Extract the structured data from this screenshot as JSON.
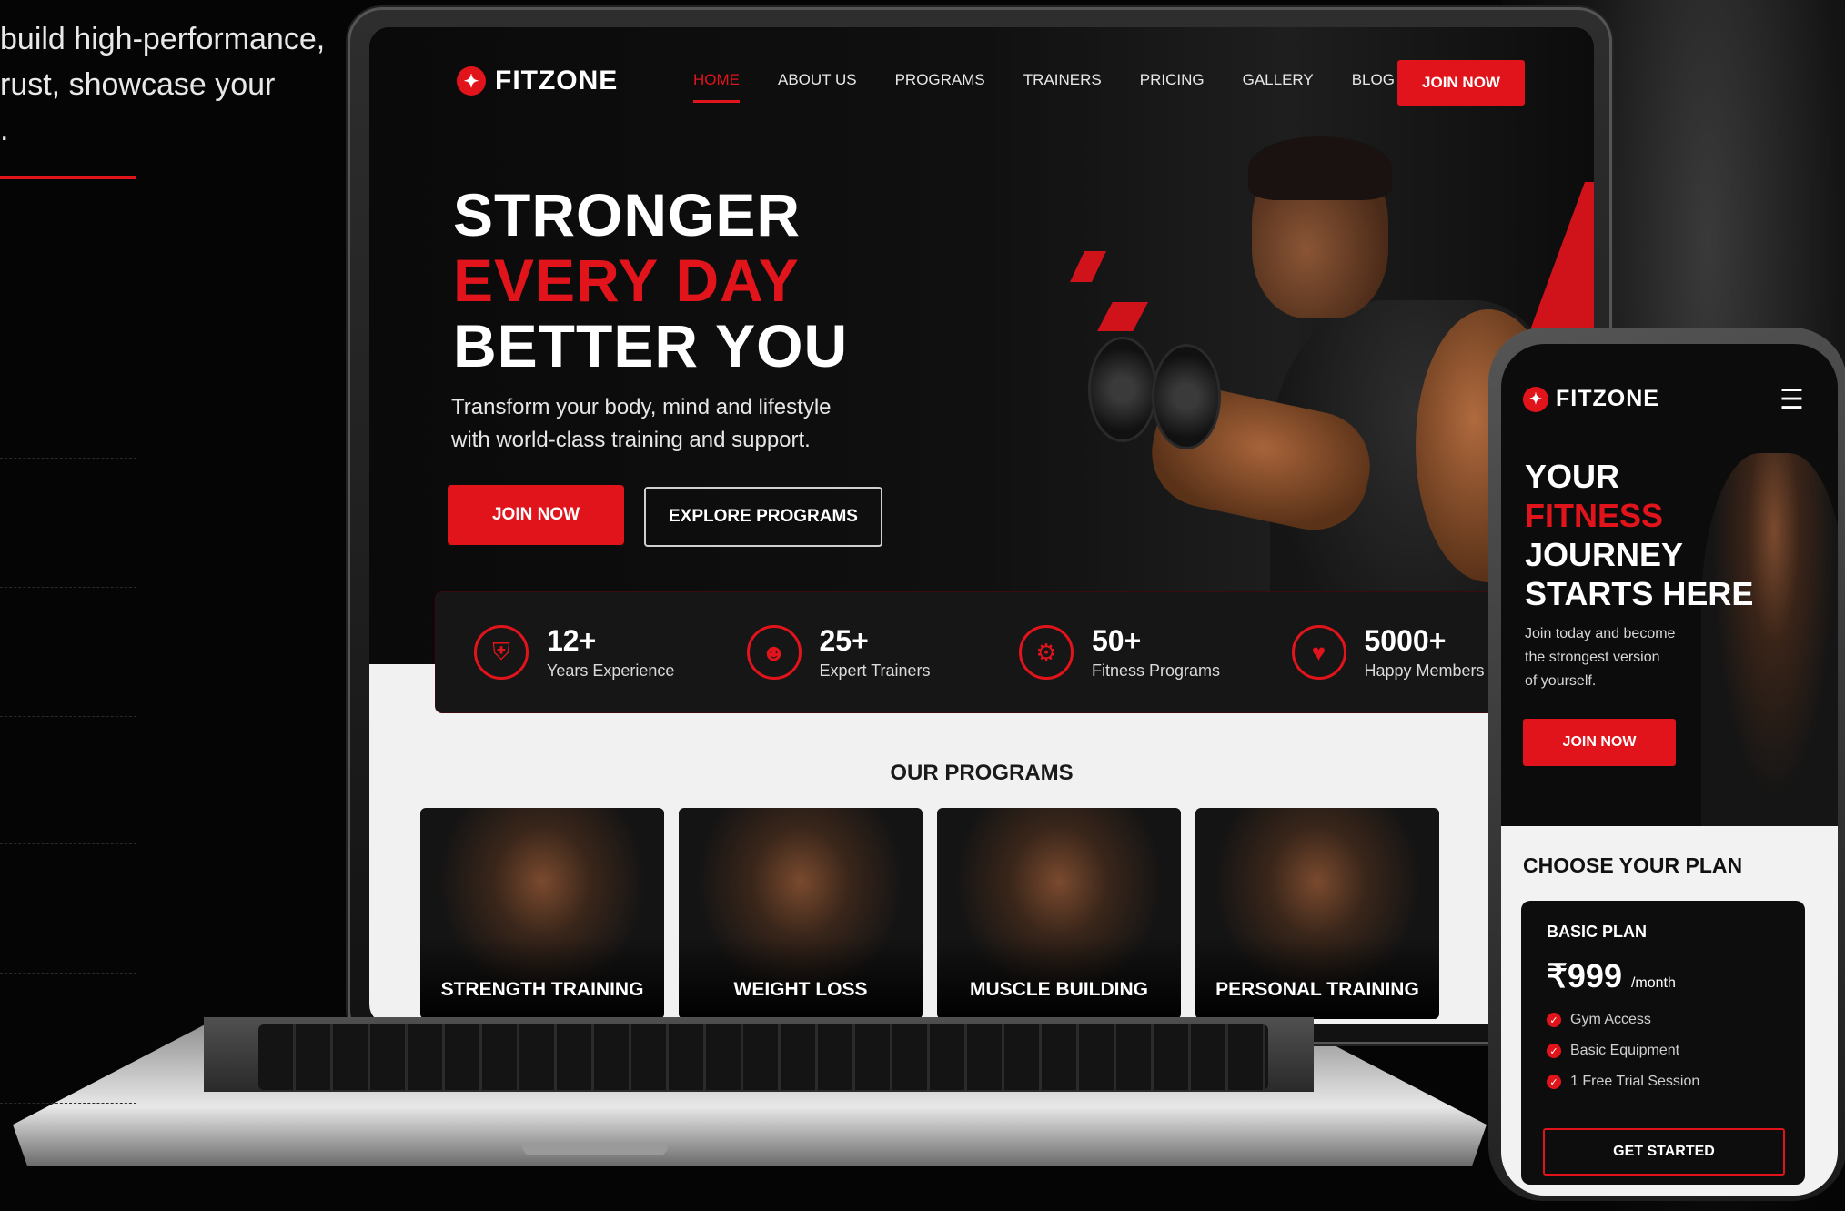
{
  "side_copy": {
    "lines": [
      "build high-performance,",
      "rust, showcase your",
      "."
    ]
  },
  "brand": {
    "name": "FITZONE",
    "accent": "#e1141b"
  },
  "nav": {
    "items": [
      "HOME",
      "ABOUT US",
      "PROGRAMS",
      "TRAINERS",
      "PRICING",
      "GALLERY",
      "BLOG"
    ],
    "active": "HOME",
    "cta": "JOIN NOW"
  },
  "hero": {
    "line1": "STRONGER",
    "line2": "EVERY DAY",
    "line3": "BETTER YOU",
    "subtitle_line1": "Transform your body, mind and lifestyle",
    "subtitle_line2": "with world-class training and support.",
    "primary_button": "JOIN NOW",
    "secondary_button": "EXPLORE PROGRAMS"
  },
  "stats": [
    {
      "value": "12+",
      "label": "Years Experience",
      "icon": "shield-icon"
    },
    {
      "value": "25+",
      "label": "Expert Trainers",
      "icon": "trainers-icon"
    },
    {
      "value": "50+",
      "label": "Fitness Programs",
      "icon": "programs-icon"
    },
    {
      "value": "5000+",
      "label": "Happy Members",
      "icon": "members-icon"
    }
  ],
  "programs": {
    "title": "OUR PROGRAMS",
    "cards": [
      "STRENGTH TRAINING",
      "WEIGHT LOSS",
      "MUSCLE BUILDING",
      "PERSONAL TRAINING"
    ]
  },
  "phone": {
    "brand": "FITZONE",
    "menu_icon": "hamburger-icon",
    "title_line1": "YOUR",
    "title_line2": "FITNESS",
    "title_line3": "JOURNEY",
    "title_line4": "STARTS HERE",
    "sub_line1": "Join today and become",
    "sub_line2": "the strongest version",
    "sub_line3": "of yourself.",
    "join_button": "JOIN NOW",
    "plan_section_title": "CHOOSE YOUR PLAN",
    "plan": {
      "name": "BASIC PLAN",
      "price": "₹999",
      "period": "/month",
      "features": [
        "Gym Access",
        "Basic Equipment",
        "1 Free Trial Session"
      ],
      "button": "GET STARTED"
    }
  }
}
